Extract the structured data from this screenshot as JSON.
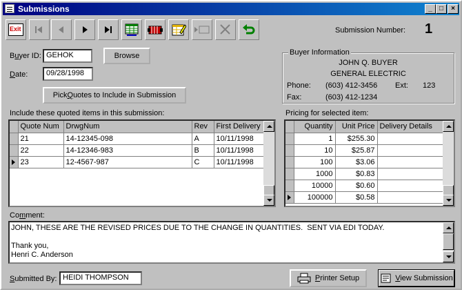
{
  "window": {
    "title": "Submissions"
  },
  "toolbar": {
    "exit_label": "Exit",
    "submission_label": "Submission Number:",
    "submission_number": "1"
  },
  "buyer": {
    "id_label_pre": "B",
    "id_label_u": "u",
    "id_label_post": "yer ID:",
    "id_value": "GEHOK",
    "browse_label": "Browse",
    "date_label_u": "D",
    "date_label_post": "ate:",
    "date_value": "09/28/1998",
    "pick_pre": "Pick ",
    "pick_u": "Q",
    "pick_post": "uotes to Include in Submission"
  },
  "buyer_info": {
    "title": "Buyer Information",
    "name": "JOHN Q. BUYER",
    "company": "GENERAL ELECTRIC",
    "phone_label": "Phone:",
    "phone": "(603) 412-3456",
    "ext_label": "Ext:",
    "ext": "123",
    "fax_label": "Fax:",
    "fax": "(603) 412-1234"
  },
  "items": {
    "label": "Include these quoted items in this submission:",
    "columns": [
      "Quote Num",
      "DrwgNum",
      "Rev",
      "First Delivery"
    ],
    "rows": [
      [
        "21",
        "14-12345-098",
        "A",
        "10/11/1998"
      ],
      [
        "22",
        "14-12346-983",
        "B",
        "10/11/1998"
      ],
      [
        "23",
        "12-4567-987",
        "C",
        "10/11/1998"
      ]
    ]
  },
  "pricing": {
    "label": "Pricing for selected item:",
    "columns": [
      "Quantity",
      "Unit Price",
      "Delivery Details"
    ],
    "rows": [
      [
        "1",
        "$255.30",
        ""
      ],
      [
        "10",
        "$25.87",
        ""
      ],
      [
        "100",
        "$3.06",
        ""
      ],
      [
        "1000",
        "$0.83",
        ""
      ],
      [
        "10000",
        "$0.60",
        ""
      ],
      [
        "100000",
        "$0.58",
        ""
      ]
    ]
  },
  "comment": {
    "label_pre": "Co",
    "label_u": "m",
    "label_post": "ment:",
    "text": "JOHN, THESE ARE THE REVISED PRICES DUE TO THE CHANGE IN QUANTITIES.  SENT VIA EDI TODAY.\n\nThank you,\nHenri C. Anderson"
  },
  "footer": {
    "submitted_label_u": "S",
    "submitted_label_post": "ubmitted By:",
    "submitted_value": "HEIDI THOMPSON",
    "printer_u": "P",
    "printer_post": "rinter Setup",
    "view_u": "V",
    "view_post": "iew Submission"
  }
}
